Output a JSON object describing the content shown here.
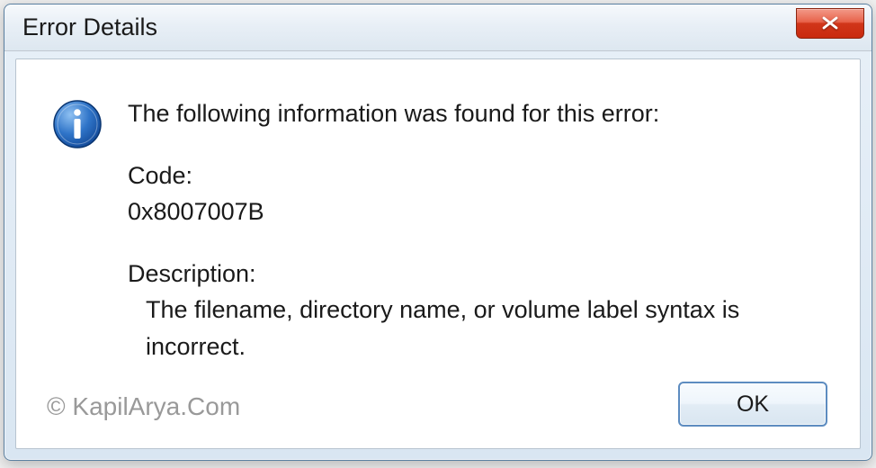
{
  "window": {
    "title": "Error Details"
  },
  "message": {
    "heading": "The following information was found for this error:",
    "code_label": "Code:",
    "code_value": "0x8007007B",
    "description_label": "Description:",
    "description_value": "The filename, directory name, or volume label syntax is incorrect."
  },
  "buttons": {
    "ok": "OK"
  },
  "watermark": {
    "text": "© KapilArya.Com"
  },
  "icons": {
    "info": "info-icon",
    "close": "close-icon"
  }
}
